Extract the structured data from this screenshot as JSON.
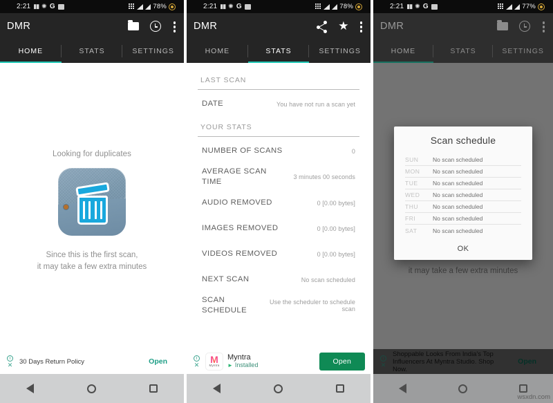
{
  "app": {
    "title": "DMR",
    "accent_color": "#1fc8b5",
    "appbar_color": "#252525"
  },
  "tabs": [
    {
      "label": "HOME"
    },
    {
      "label": "STATS"
    },
    {
      "label": "SETTINGS"
    }
  ],
  "panels": [
    {
      "name": "home-screen",
      "statusbar": {
        "time": "2:21",
        "battery": "78%"
      },
      "active_tab": "HOME",
      "actions": [
        "folder-icon",
        "clock-icon",
        "overflow-menu-icon"
      ],
      "home": {
        "looking_text": "Looking for duplicates",
        "since_line1": "Since this is the first scan,",
        "since_line2": "it may take a few extra minutes"
      },
      "ad": {
        "text": "30 Days Return Policy",
        "cta": "Open",
        "info_glyph": "i",
        "close_glyph": "✕"
      }
    },
    {
      "name": "stats-screen",
      "statusbar": {
        "time": "2:21",
        "battery": "78%"
      },
      "active_tab": "STATS",
      "actions": [
        "share-icon",
        "star-icon",
        "overflow-menu-icon"
      ],
      "stats": {
        "section_last_scan": "LAST SCAN",
        "section_your_stats": "YOUR STATS",
        "last_scan_rows": [
          {
            "label": "DATE",
            "value": "You have not run a scan yet"
          }
        ],
        "your_stats_rows": [
          {
            "label": "NUMBER OF SCANS",
            "value": "0"
          },
          {
            "label": "AVERAGE SCAN TIME",
            "value": "3 minutes 00 seconds"
          },
          {
            "label": "AUDIO REMOVED",
            "value": "0 [0.00 bytes]"
          },
          {
            "label": "IMAGES REMOVED",
            "value": "0 [0.00 bytes]"
          },
          {
            "label": "VIDEOS REMOVED",
            "value": "0 [0.00 bytes]"
          },
          {
            "label": "NEXT SCAN",
            "value": "No scan scheduled"
          },
          {
            "label": "SCAN SCHEDULE",
            "value": "Use the scheduler to schedule scan"
          }
        ]
      },
      "ad": {
        "app_name": "Myntra",
        "logo_label": "Myntra",
        "logo_letter": "M",
        "installed": "Installed",
        "cta": "Open",
        "info_glyph": "i",
        "close_glyph": "✕"
      }
    },
    {
      "name": "scan-schedule-dialog-screen",
      "statusbar": {
        "time": "2:21",
        "battery": "77%"
      },
      "active_tab": "HOME",
      "actions": [
        "folder-icon",
        "clock-icon",
        "overflow-menu-icon"
      ],
      "background_text": "it may take a few extra minutes",
      "dialog": {
        "title": "Scan schedule",
        "rows": [
          {
            "day": "SUN",
            "value": "No scan scheduled"
          },
          {
            "day": "MON",
            "value": "No scan scheduled"
          },
          {
            "day": "TUE",
            "value": "No scan scheduled"
          },
          {
            "day": "WED",
            "value": "No scan scheduled"
          },
          {
            "day": "THU",
            "value": "No scan scheduled"
          },
          {
            "day": "FRI",
            "value": "No scan scheduled"
          },
          {
            "day": "SAT",
            "value": "No scan scheduled"
          }
        ],
        "ok_label": "OK"
      },
      "ad": {
        "text": "Shoppable Looks From India's Top Influencers At Myntra Studio. Shop Now.",
        "cta": "Open",
        "info_glyph": "i",
        "close_glyph": "✕"
      },
      "watermark": "wsxdn.com"
    }
  ]
}
